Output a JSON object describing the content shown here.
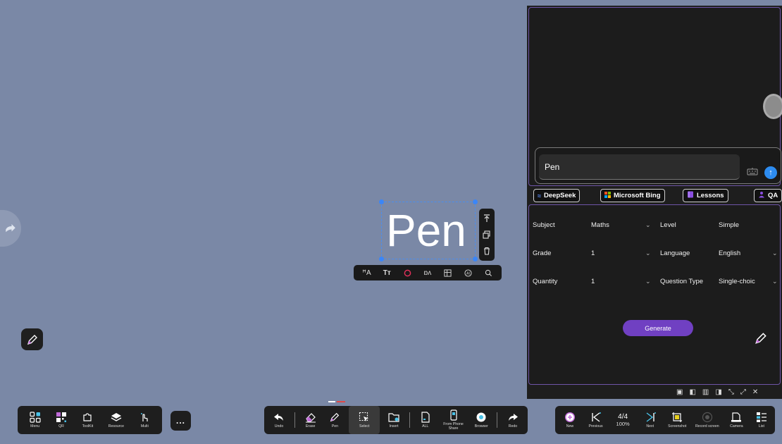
{
  "canvas": {
    "background": "#7a88a6",
    "selected_text": "Pen"
  },
  "ai_panel": {
    "input_value": "Pen",
    "chips": [
      {
        "label": "DeepSeek",
        "icon": "deepseek-icon"
      },
      {
        "label": "Microsoft Bing",
        "icon": "windows-logo-icon"
      },
      {
        "label": "Lessons",
        "icon": "book-icon"
      },
      {
        "label": "QA",
        "icon": "people-icon"
      }
    ],
    "form": {
      "subject_label": "Subject",
      "subject_value": "Maths",
      "level_label": "Level",
      "level_value": "Simple",
      "grade_label": "Grade",
      "grade_value": "1",
      "language_label": "Language",
      "language_value": "English",
      "quantity_label": "Quantity",
      "quantity_value": "1",
      "question_type_label": "Question Type",
      "question_type_value": "Single-choic"
    },
    "generate_label": "Generate",
    "accent": "#7040c2",
    "border_accent": "#6e55a8"
  },
  "left_toolbar": {
    "items": [
      {
        "label": "Menu",
        "icon": "menu-grid-icon"
      },
      {
        "label": "QR",
        "icon": "qr-code-icon"
      },
      {
        "label": "ToolKit",
        "icon": "toolkit-icon"
      },
      {
        "label": "Resource",
        "icon": "layers-icon"
      },
      {
        "label": "Multi",
        "icon": "multi-touch-icon"
      }
    ],
    "more_label": "..."
  },
  "center_toolbar": {
    "items": [
      {
        "label": "Undo",
        "icon": "undo-icon"
      },
      {
        "label": "Erase",
        "icon": "eraser-icon"
      },
      {
        "label": "Pen",
        "icon": "pen-icon"
      },
      {
        "label": "Select",
        "icon": "select-icon"
      },
      {
        "label": "Insert",
        "icon": "insert-folder-icon"
      },
      {
        "label": "ALL",
        "icon": "document-icon"
      },
      {
        "label": "From Phone Share",
        "icon": "phone-icon"
      },
      {
        "label": "Browser",
        "icon": "browser-icon"
      },
      {
        "label": "Redo",
        "icon": "redo-icon"
      }
    ]
  },
  "right_toolbar": {
    "items": [
      {
        "label": "New",
        "icon": "add-page-icon"
      },
      {
        "label": "Previous",
        "icon": "previous-icon"
      },
      {
        "label": "Next",
        "icon": "next-icon"
      },
      {
        "label": "Screenshot",
        "icon": "screenshot-icon"
      },
      {
        "label": "Record screen",
        "icon": "record-icon"
      },
      {
        "label": "Camera",
        "icon": "camera-icon"
      },
      {
        "label": "List",
        "icon": "list-icon"
      }
    ],
    "page_indicator": "4/4",
    "zoom": "100%"
  }
}
